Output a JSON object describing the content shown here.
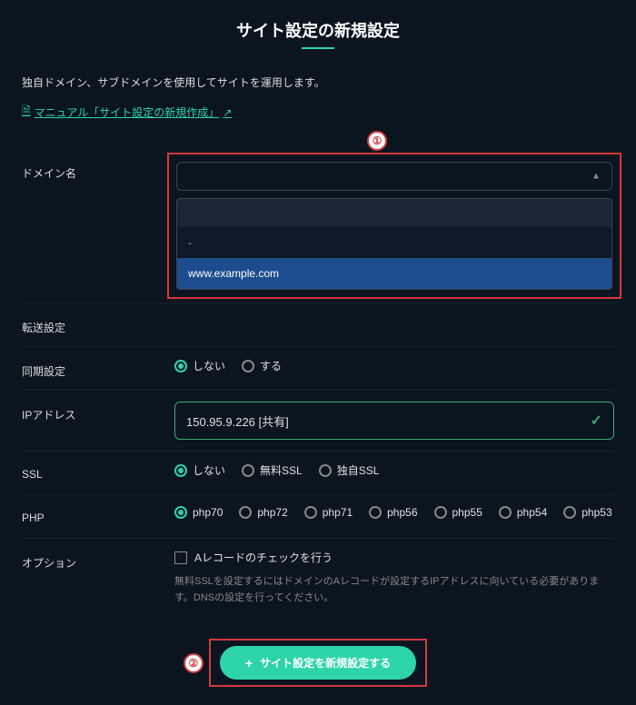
{
  "title": "サイト設定の新規設定",
  "description": "独自ドメイン、サブドメインを使用してサイトを運用します。",
  "manual_link": "マニュアル「サイト設定の新規作成」",
  "annotations": {
    "one": "①",
    "two": "②"
  },
  "labels": {
    "domain": "ドメイン名",
    "transfer": "転送設定",
    "sync": "同期設定",
    "ip": "IPアドレス",
    "ssl": "SSL",
    "php": "PHP",
    "option": "オプション"
  },
  "dropdown": {
    "dash": "-",
    "selected": "www.example.com"
  },
  "sync_options": {
    "no": "しない",
    "yes": "する"
  },
  "ip_value": "150.95.9.226 [共有]",
  "ssl_options": {
    "no": "しない",
    "free": "無料SSL",
    "own": "独自SSL"
  },
  "php_options": {
    "php70": "php70",
    "php72": "php72",
    "php71": "php71",
    "php56": "php56",
    "php55": "php55",
    "php54": "php54",
    "php53": "php53"
  },
  "option_checkbox": "Aレコードのチェックを行う",
  "option_help": "無料SSLを設定するにはドメインのAレコードが設定するIPアドレスに向いている必要があります。DNSの設定を行ってください。",
  "submit": "サイト設定を新規設定する"
}
